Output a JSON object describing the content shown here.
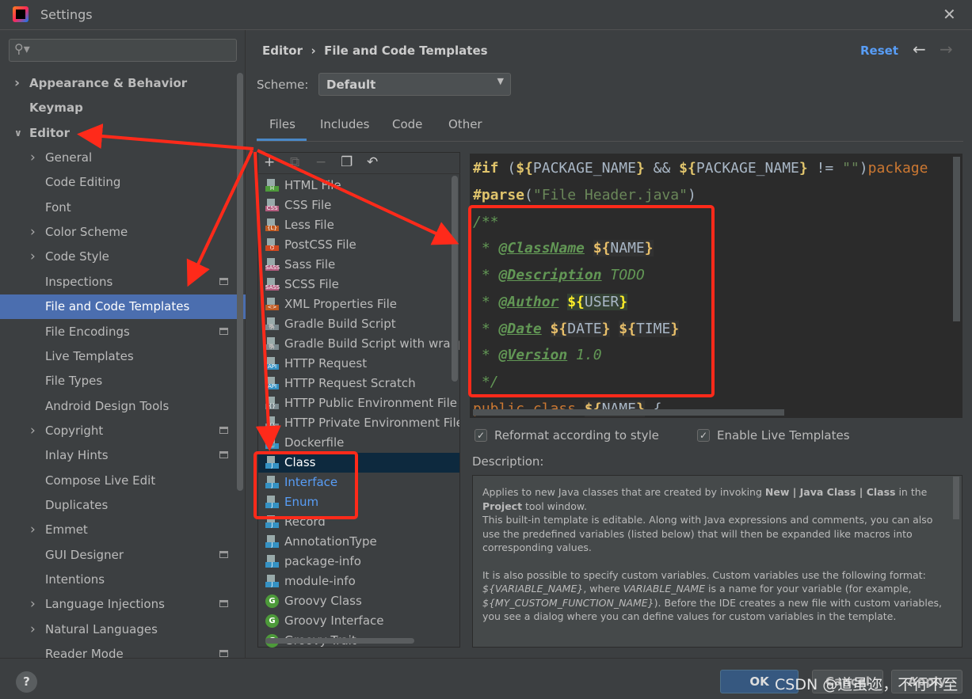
{
  "window": {
    "title": "Settings",
    "close_icon": "close-icon"
  },
  "search": {
    "placeholder": ""
  },
  "sidebar": {
    "items": [
      {
        "label": "Appearance & Behavior",
        "level": 0,
        "expander": "collapsed"
      },
      {
        "label": "Keymap",
        "level": 0,
        "expander": "none"
      },
      {
        "label": "Editor",
        "level": 0,
        "expander": "expanded"
      },
      {
        "label": "General",
        "level": 1,
        "expander": "collapsed"
      },
      {
        "label": "Code Editing",
        "level": 1,
        "expander": "none"
      },
      {
        "label": "Font",
        "level": 1,
        "expander": "none"
      },
      {
        "label": "Color Scheme",
        "level": 1,
        "expander": "collapsed"
      },
      {
        "label": "Code Style",
        "level": 1,
        "expander": "collapsed"
      },
      {
        "label": "Inspections",
        "level": 1,
        "expander": "none",
        "project_icon": true
      },
      {
        "label": "File and Code Templates",
        "level": 1,
        "expander": "none",
        "selected": true
      },
      {
        "label": "File Encodings",
        "level": 1,
        "expander": "none",
        "project_icon": true
      },
      {
        "label": "Live Templates",
        "level": 1,
        "expander": "none"
      },
      {
        "label": "File Types",
        "level": 1,
        "expander": "none"
      },
      {
        "label": "Android Design Tools",
        "level": 1,
        "expander": "none"
      },
      {
        "label": "Copyright",
        "level": 1,
        "expander": "collapsed",
        "project_icon": true
      },
      {
        "label": "Inlay Hints",
        "level": 1,
        "expander": "none",
        "project_icon": true
      },
      {
        "label": "Compose Live Edit",
        "level": 1,
        "expander": "none"
      },
      {
        "label": "Duplicates",
        "level": 1,
        "expander": "none"
      },
      {
        "label": "Emmet",
        "level": 1,
        "expander": "collapsed"
      },
      {
        "label": "GUI Designer",
        "level": 1,
        "expander": "none",
        "project_icon": true
      },
      {
        "label": "Intentions",
        "level": 1,
        "expander": "none"
      },
      {
        "label": "Language Injections",
        "level": 1,
        "expander": "collapsed",
        "project_icon": true
      },
      {
        "label": "Natural Languages",
        "level": 1,
        "expander": "collapsed"
      },
      {
        "label": "Reader Mode",
        "level": 1,
        "expander": "none",
        "project_icon": true
      }
    ]
  },
  "header": {
    "breadcrumb_parent": "Editor",
    "breadcrumb_sep": "›",
    "breadcrumb_current": "File and Code Templates",
    "reset": "Reset"
  },
  "scheme": {
    "label": "Scheme:",
    "value": "Default"
  },
  "tabs": [
    {
      "label": "Files",
      "active": true
    },
    {
      "label": "Includes"
    },
    {
      "label": "Code"
    },
    {
      "label": "Other"
    }
  ],
  "toolbar": {
    "add": "+",
    "copy": "⧉",
    "remove": "−",
    "duplicate": "❐",
    "revert": "↶"
  },
  "templates": [
    {
      "label": "HTML File",
      "badge": "H",
      "color": "#4d9a3a"
    },
    {
      "label": "CSS File",
      "badge": "CSS",
      "color": "#b35c7e"
    },
    {
      "label": "Less File",
      "badge": "{L}",
      "color": "#c05a22"
    },
    {
      "label": "PostCSS File",
      "badge": "⌬",
      "color": "#d0471f"
    },
    {
      "label": "Sass File",
      "badge": "SASS",
      "color": "#b35c7e"
    },
    {
      "label": "SCSS File",
      "badge": "SASS",
      "color": "#b35c7e"
    },
    {
      "label": "XML Properties File",
      "badge": "<>",
      "color": "#c05a22"
    },
    {
      "label": "Gradle Build Script",
      "badge": "🐘",
      "color": "#7c8a8f"
    },
    {
      "label": "Gradle Build Script with wrapper",
      "badge": "🐘",
      "color": "#7c8a8f"
    },
    {
      "label": "HTTP Request",
      "badge": "API",
      "color": "#3592c4"
    },
    {
      "label": "HTTP Request Scratch",
      "badge": "API",
      "color": "#3592c4"
    },
    {
      "label": "HTTP Public Environment File",
      "badge": "{}",
      "color": "#7c8a8f"
    },
    {
      "label": "HTTP Private Environment File",
      "badge": "{}",
      "color": "#7c8a8f"
    },
    {
      "label": "Dockerfile",
      "badge": "🐳",
      "color": "#3592c4"
    },
    {
      "label": "Class",
      "badge": "J",
      "color": "#3592c4",
      "selected": true
    },
    {
      "label": "Interface",
      "badge": "J",
      "color": "#3592c4",
      "highlight": "#589df6"
    },
    {
      "label": "Enum",
      "badge": "J",
      "color": "#3592c4",
      "highlight": "#589df6"
    },
    {
      "label": "Record",
      "badge": "J",
      "color": "#3592c4"
    },
    {
      "label": "AnnotationType",
      "badge": "J",
      "color": "#3592c4"
    },
    {
      "label": "package-info",
      "badge": "J",
      "color": "#3592c4"
    },
    {
      "label": "module-info",
      "badge": "J",
      "color": "#3592c4"
    },
    {
      "label": "Groovy Class",
      "badge": "G",
      "color": "#4d9a3a",
      "round": true
    },
    {
      "label": "Groovy Interface",
      "badge": "G",
      "color": "#4d9a3a",
      "round": true
    },
    {
      "label": "Groovy Trait",
      "badge": "G",
      "color": "#4d9a3a",
      "round": true
    }
  ],
  "code": {
    "l1": {
      "a": "#if",
      "b": " (",
      "c": "${",
      "d": "PACKAGE_NAME",
      "e": "}",
      "f": " && ",
      "g": "${",
      "h": "PACKAGE_NAME",
      "i": "}",
      "j": " != ",
      "k": "\"\"",
      "l": ")",
      "m": "package"
    },
    "l2": {
      "a": "#parse",
      "b": "(",
      "c": "\"File Header.java\"",
      "d": ")"
    },
    "l3": "/**",
    "l4": {
      "star": " * ",
      "tag": "@ClassName",
      "sp": " ",
      "v1": "${",
      "v2": "NAME",
      "v3": "}"
    },
    "l5": {
      "star": " * ",
      "tag": "@Description",
      "rest": " TODO"
    },
    "l6": {
      "star": " * ",
      "tag": "@Author",
      "sp": " ",
      "v1": "${",
      "v2": "USER",
      "v3": "}"
    },
    "l7": {
      "star": " * ",
      "tag": "@Date",
      "sp": " ",
      "v1": "${",
      "v2": "DATE",
      "v3": "}",
      "sp2": " ",
      "w1": "${",
      "w2": "TIME",
      "w3": "}"
    },
    "l8": {
      "star": " * ",
      "tag": "@Version",
      "rest": " 1.0"
    },
    "l9": " */",
    "l10": {
      "a": "public class ",
      "v1": "${",
      "v2": "NAME",
      "v3": "}",
      "b": " {"
    }
  },
  "options": {
    "reformat": {
      "label": "Reformat according to style",
      "checked": true
    },
    "live": {
      "label": "Enable Live Templates",
      "checked": true
    }
  },
  "description": {
    "label": "Description:",
    "p1a": "Applies to new Java classes that are created by invoking ",
    "p1b": "New | Java Class | Class",
    "p1c": " in the ",
    "p1d": "Project",
    "p1e": " tool window.",
    "p2": "This built-in template is editable. Along with Java expressions and comments, you can also use the predefined variables (listed below) that will then be expanded like macros into corresponding values.",
    "p3a": "It is also possible to specify custom variables. Custom variables use the following format: ",
    "p3b": "${VARIABLE_NAME}",
    "p3c": ", where ",
    "p3d": "VARIABLE_NAME",
    "p3e": " is a name for your variable (for example, ",
    "p3f": "${MY_CUSTOM_FUNCTION_NAME}",
    "p3g": "). Before the IDE creates a new file with custom variables, you see a dialog where you can define values for custom variables in the template."
  },
  "footer": {
    "help": "?",
    "ok": "OK",
    "cancel": "Cancel",
    "apply": "Apply"
  },
  "watermark": "CSDN @道虽迩，不行不至",
  "colors": {
    "accent": "#4b6eaf",
    "link": "#589df6",
    "annotation": "#ff2a1a"
  }
}
